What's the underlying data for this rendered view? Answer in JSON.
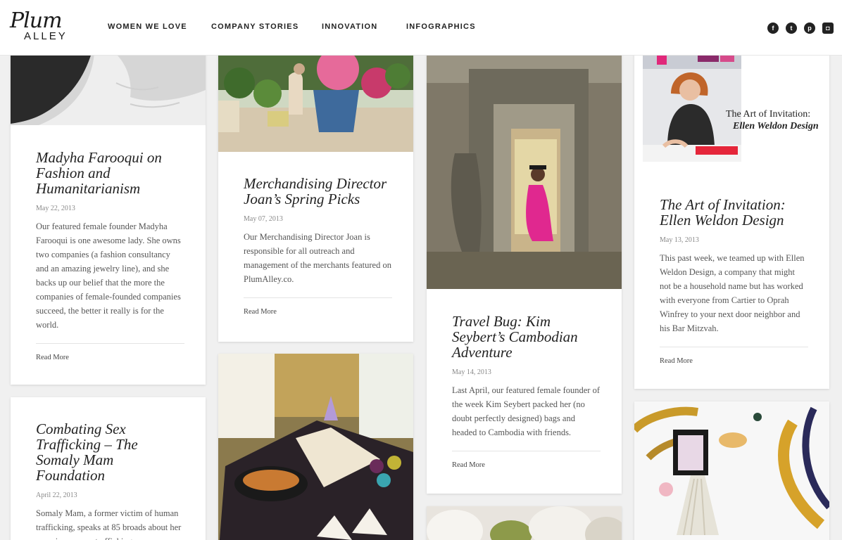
{
  "brand": {
    "logo_top": "Plum",
    "logo_bottom": "ALLEY"
  },
  "nav": [
    {
      "label": "WOMEN WE LOVE"
    },
    {
      "label": "COMPANY STORIES"
    },
    {
      "label": "INNOVATION"
    },
    {
      "label": "INFOGRAPHICS"
    }
  ],
  "social": [
    {
      "icon": "facebook-icon",
      "glyph": "f"
    },
    {
      "icon": "twitter-icon",
      "glyph": "t"
    },
    {
      "icon": "pinterest-icon",
      "glyph": "p"
    },
    {
      "icon": "instagram-icon",
      "glyph": "◘"
    }
  ],
  "posts": [
    {
      "title": "Madyha Farooqui on Fashion and Humanitarianism",
      "date": "May 22, 2013",
      "excerpt": "Our featured female founder Madyha Farooqui is one awesome lady. She owns two companies (a fashion consultancy and an amazing jewelry line), and she backs up our belief that the more the companies of female-founded companies succeed, the better it really is for the world.",
      "read_more": "Read More"
    },
    {
      "title": "Merchandising Director Joan’s Spring Picks",
      "date": "May 07, 2013",
      "excerpt": "Our Merchandising Director Joan is responsible for all outreach and management of the merchants featured on PlumAlley.co.",
      "read_more": "Read More"
    },
    {
      "title": "Travel Bug: Kim Seybert’s Cambodian Adventure",
      "date": "May 14, 2013",
      "excerpt": "Last April, our featured female founder of the week Kim Seybert packed her (no doubt perfectly designed) bags and headed to Cambodia with friends.",
      "read_more": "Read More"
    },
    {
      "title": "The Art of Invitation: Ellen Weldon Design",
      "date": "May 13, 2013",
      "excerpt": "This past week, we teamed up with Ellen Weldon Design, a company that might not be a household name but has worked with everyone from Cartier to Oprah Winfrey to your next door neighbor and his Bar Mitzvah.",
      "read_more": "Read More",
      "image_caption_line1": "The Art of Invitation:",
      "image_caption_line2": "Ellen Weldon Design"
    },
    {
      "title": "Combating Sex Trafficking – The Somaly Mam Foundation",
      "date": "April 22, 2013",
      "excerpt": "Somaly Mam, a former victim of human trafficking, speaks at 85 broads about her experiences as a trafficking"
    }
  ]
}
